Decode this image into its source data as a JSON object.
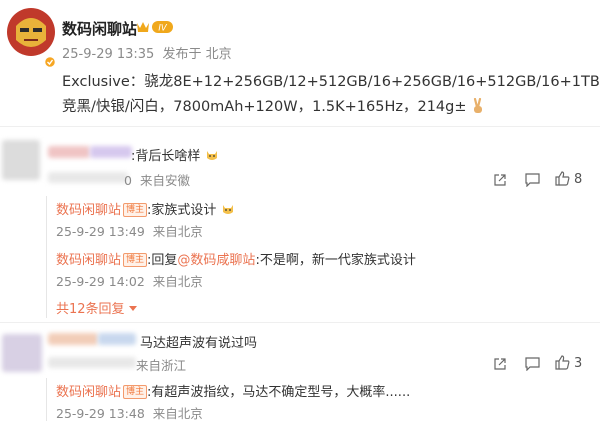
{
  "post": {
    "author": "数码闲聊站",
    "vip_level": "IV",
    "time": "25-9-29 13:35",
    "source": "发布于 北京",
    "line1": "Exclusive：骁龙8E+12+256GB/12+512GB/16+256GB/16+512GB/16+1TB，",
    "line2": "竞黑/快银/闪白，7800mAh+120W，1.5K+165Hz，214g±"
  },
  "comments": [
    {
      "text": ":背后长啥样",
      "time_partial": "0",
      "source": "来自安徽",
      "likes": "8",
      "replies": [
        {
          "name": "数码闲聊站",
          "tag": "博主",
          "text": ":家族式设计",
          "time": "25-9-29 13:49",
          "source": "来自北京"
        },
        {
          "name": "数码闲聊站",
          "tag": "博主",
          "text_prefix": ":回复",
          "mention": "@数码咸聊站",
          "text": ":不是啊，新一代家族式设计",
          "time": "25-9-29 14:02",
          "source": "来自北京"
        }
      ],
      "more_replies": "共12条回复"
    },
    {
      "text": "马达超声波有说过吗",
      "source": "来自浙江",
      "likes": "3",
      "replies": [
        {
          "name": "数码闲聊站",
          "tag": "博主",
          "text": ":有超声波指纹，马达不确定型号，大概率......",
          "time": "25-9-29 13:48",
          "source": "来自北京"
        }
      ]
    }
  ],
  "icons": {
    "verified": "orange-verified-badge",
    "emoji_victory": "victory-hand-emoji",
    "emoji_cat": "cat-face-emoji",
    "share": "share-icon",
    "comment": "comment-icon",
    "like": "thumbs-up-icon",
    "more": "chevron-down-icon"
  },
  "colors": {
    "accent": "#eb7350",
    "meta": "#8a8a8a"
  }
}
